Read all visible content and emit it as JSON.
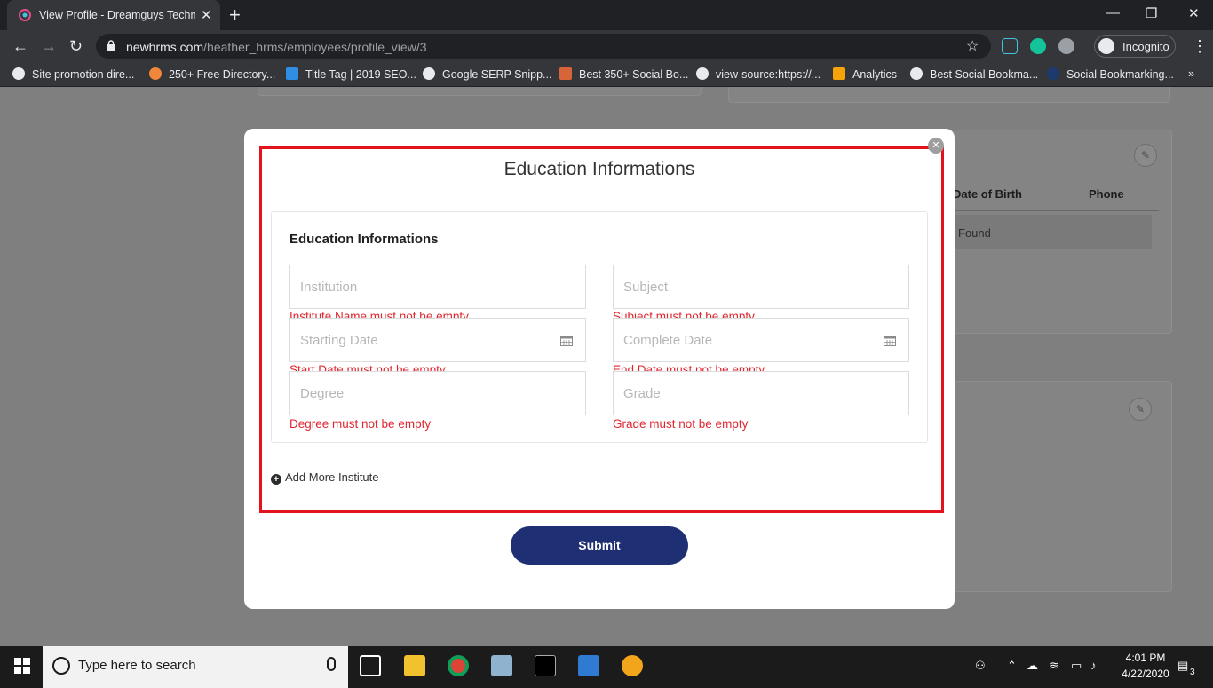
{
  "browser": {
    "tab_title": "View Profile - Dreamguys Technologies",
    "url_domain": "newhrms.com",
    "url_path": "/heather_hrms/employees/profile_view/3",
    "incognito_label": "Incognito",
    "bookmarks": [
      "Site promotion dire...",
      "250+ Free Directory...",
      "Title Tag | 2019 SEO...",
      "Google SERP Snipp...",
      "Best 350+ Social Bo...",
      "view-source:https://...",
      "Analytics",
      "Best Social Bookma...",
      "Social Bookmarking..."
    ],
    "more_bookmarks": "»"
  },
  "background": {
    "col_date_of_birth": "Date of Birth",
    "col_phone": "Phone",
    "found_text": "Found"
  },
  "modal": {
    "title": "Education Informations",
    "section_title": "Education Informations",
    "fields": {
      "institution": {
        "placeholder": "Institution",
        "error": "Institute Name must not be empty"
      },
      "subject": {
        "placeholder": "Subject",
        "error": "Subject must not be empty"
      },
      "starting_date": {
        "placeholder": "Starting Date",
        "error": "Start Date must not be empty"
      },
      "complete_date": {
        "placeholder": "Complete Date",
        "error": "End Date must not be empty"
      },
      "degree": {
        "placeholder": "Degree",
        "error": "Degree must not be empty"
      },
      "grade": {
        "placeholder": "Grade",
        "error": "Grade must not be empty"
      }
    },
    "add_more_label": "Add More Institute",
    "submit_label": "Submit",
    "highlight_color": "#e2131c",
    "submit_color": "#1f2f73",
    "error_color": "#e0262f"
  },
  "taskbar": {
    "search_placeholder": "Type here to search",
    "time": "4:01 PM",
    "date": "4/22/2020",
    "notification_count": "3"
  }
}
